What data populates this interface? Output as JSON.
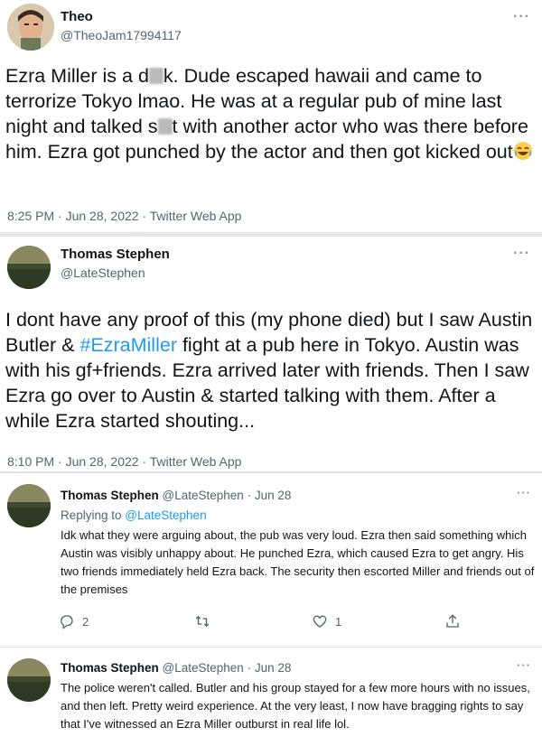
{
  "tweet1": {
    "author_name": "Theo",
    "author_handle": "@TheoJam17994117",
    "text_parts": {
      "p1": "Ezra Miller is a d",
      "p2": "k. Dude escaped hawaii and came to terrorize Tokyo lmao. He was at a regular pub of mine last night and talked s",
      "p3": "t with another actor who was there before him. Ezra got punched by the actor and then got kicked out"
    },
    "emoji": "face-with-tears-of-joy",
    "time": "8:25 PM",
    "date": "Jun 28, 2022",
    "source": "Twitter Web App",
    "dot": "·"
  },
  "tweet2": {
    "author_name": "Thomas Stephen",
    "author_handle": "@LateStephen",
    "text_parts": {
      "p1": "I dont have any proof of this (my phone died) but I saw Austin Butler & ",
      "hashtag": "#EzraMiller",
      "p2": " fight at a pub here in Tokyo. Austin was with his gf+friends. Ezra arrived later with friends. Then I saw Ezra go over to Austin & started talking with them. After a while Ezra started shouting..."
    },
    "time": "8:10 PM",
    "date": "Jun 28, 2022",
    "source": "Twitter Web App",
    "dot": "·"
  },
  "reply1": {
    "author_name": "Thomas Stephen",
    "author_handle": "@LateStephen",
    "date": "Jun 28",
    "dot": "·",
    "replying_prefix": "Replying to ",
    "replying_to": "@LateStephen",
    "text": "Idk what they were arguing about, the pub was very loud. Ezra then said something which Austin was visibly unhappy about. He punched Ezra, which caused Ezra to get angry. His two friends immediately held Ezra back. The security then escorted Miller and friends out of the premises",
    "reply_count": "2",
    "retweet_count": "",
    "like_count": "1"
  },
  "reply2": {
    "author_name": "Thomas Stephen",
    "author_handle": "@LateStephen",
    "date": "Jun 28",
    "dot": "·",
    "text": "The police weren't called. Butler and his group stayed for a few more hours with no issues, and then left. Pretty weird experience. At the very least, I now have bragging rights to say that I've witnessed an Ezra Miller outburst in real life lol."
  },
  "more_label": "···",
  "colors": {
    "link": "#1d9bf0",
    "secondary_text": "#536471",
    "primary_text": "#0f1419"
  }
}
